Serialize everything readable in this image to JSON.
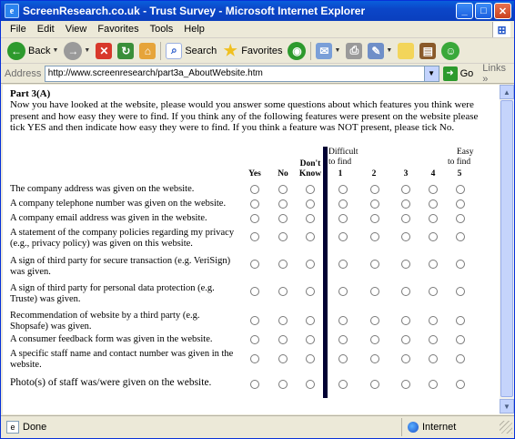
{
  "window": {
    "title": "ScreenResearch.co.uk - Trust Survey - Microsoft Internet Explorer"
  },
  "menu": [
    "File",
    "Edit",
    "View",
    "Favorites",
    "Tools",
    "Help"
  ],
  "toolbar": {
    "back": "Back",
    "search": "Search",
    "favorites": "Favorites"
  },
  "address": {
    "label": "Address",
    "url": "http://www.screenresearch/part3a_AboutWebsite.htm",
    "go": "Go",
    "links": "Links"
  },
  "survey": {
    "part_title": "Part 3(A)",
    "intro": "Now you have looked at the website, please would you answer some questions about which features you think were present and how easy they were to find. If you think any of the following features were present on the website please tick YES and then indicate how easy they were to find. If you think a feature was NOT present, please tick No.",
    "headers": {
      "yes": "Yes",
      "no": "No",
      "dont_know_1": "Don't",
      "dont_know_2": "Know",
      "difficult_1": "Difficult",
      "difficult_2": "to find",
      "easy_1": "Easy",
      "easy_2": "to find",
      "scale": [
        "1",
        "2",
        "3",
        "4",
        "5"
      ]
    },
    "questions": [
      "The company address was given on the website.",
      "A company telephone number was given on the website.",
      "A company email address was given in the website.",
      "A statement of the company policies regarding my privacy (e.g., privacy policy) was given on this website.",
      "A sign of third party for secure transaction (e.g. VeriSign) was given.",
      "A sign of third party for personal data protection (e.g. Truste) was given.",
      "Recommendation of website by a third party (e.g. Shopsafe) was given.",
      "A consumer feedback form was given in the website.",
      "A specific staff name and contact number was given in the website.",
      "Photo(s) of staff was/were given on the website."
    ]
  },
  "status": {
    "text": "Done",
    "zone": "Internet"
  }
}
